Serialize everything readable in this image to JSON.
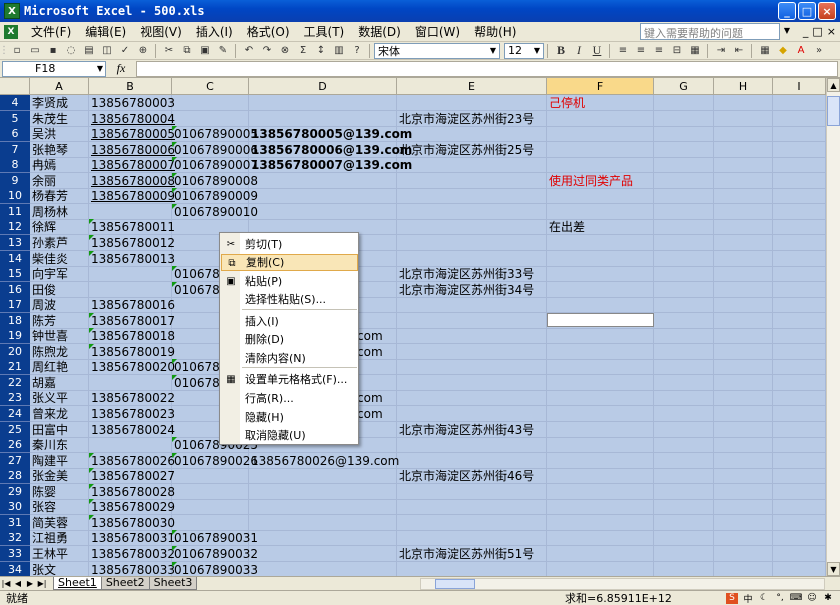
{
  "window": {
    "title": "Microsoft Excel - 500.xls",
    "app_icon": "excel-icon",
    "buttons": [
      "_",
      "□",
      "×"
    ]
  },
  "menu": {
    "items": [
      "文件(F)",
      "编辑(E)",
      "视图(V)",
      "插入(I)",
      "格式(O)",
      "工具(T)",
      "数据(D)",
      "窗口(W)",
      "帮助(H)"
    ],
    "help_placeholder": "键入需要帮助的问题",
    "doc_buttons": [
      "_",
      "□",
      "×"
    ]
  },
  "toolbar": {
    "font_name": "宋体",
    "font_size": "12",
    "sigma": "Σ",
    "bold": "B",
    "italic": "I",
    "underline": "U"
  },
  "formula_bar": {
    "name_box": "F18",
    "fx": "fx",
    "value": ""
  },
  "columns": [
    "A",
    "B",
    "C",
    "D",
    "E",
    "F",
    "G",
    "H",
    "I"
  ],
  "selected_column": "F",
  "rows": [
    {
      "n": "4",
      "A": "李贤成",
      "B": "13856780003",
      "C": "",
      "D": "",
      "E": "",
      "F": "己停机"
    },
    {
      "n": "5",
      "A": "朱茂生",
      "B": "13856780004",
      "C": "",
      "D": "",
      "E": "北京市海淀区苏州街23号",
      "F": ""
    },
    {
      "n": "6",
      "A": "吴洪",
      "B": "13856780005",
      "C": "01067890005",
      "D": "13856780005@139.com",
      "E": "",
      "F": ""
    },
    {
      "n": "7",
      "A": "张艳琴",
      "B": "13856780006",
      "C": "01067890006",
      "D": "13856780006@139.com",
      "E": "北京市海淀区苏州街25号",
      "F": ""
    },
    {
      "n": "8",
      "A": "冉嫣",
      "B": "13856780007",
      "C": "01067890007",
      "D": "13856780007@139.com",
      "E": "",
      "F": ""
    },
    {
      "n": "9",
      "A": "余丽",
      "B": "13856780008",
      "C": "01067890008",
      "D": "",
      "E": "",
      "F": "使用过同类产品"
    },
    {
      "n": "10",
      "A": "杨春芳",
      "B": "13856780009",
      "C": "01067890009",
      "D": "",
      "E": "",
      "F": ""
    },
    {
      "n": "11",
      "A": "周杨林",
      "B": "",
      "C": "01067890010",
      "D": "",
      "E": "",
      "F": ""
    },
    {
      "n": "12",
      "A": "徐辉",
      "B": "13856780011",
      "C": "",
      "D": "",
      "E": "",
      "F": "在出差"
    },
    {
      "n": "13",
      "A": "孙素芦",
      "B": "13856780012",
      "C": "",
      "D": "",
      "E": "",
      "F": ""
    },
    {
      "n": "14",
      "A": "柴佳炎",
      "B": "13856780013",
      "C": "",
      "D": "",
      "E": "",
      "F": ""
    },
    {
      "n": "15",
      "A": "向宇军",
      "B": "",
      "C": "0106789",
      "D": "",
      "E": "北京市海淀区苏州街33号",
      "F": ""
    },
    {
      "n": "16",
      "A": "田俊",
      "B": "",
      "C": "0106789",
      "D": "",
      "E": "北京市海淀区苏州街34号",
      "F": ""
    },
    {
      "n": "17",
      "A": "周波",
      "B": "13856780016",
      "C": "",
      "D": "",
      "E": "",
      "F": ""
    },
    {
      "n": "18",
      "A": "陈芳",
      "B": "13856780017",
      "C": "",
      "D": "",
      "E": "",
      "F": ""
    },
    {
      "n": "19",
      "A": "钟世喜",
      "B": "13856780018",
      "C": "",
      "D": "com",
      "E": "",
      "F": ""
    },
    {
      "n": "20",
      "A": "陈煦龙",
      "B": "13856780019",
      "C": "",
      "D": "com",
      "E": "",
      "F": ""
    },
    {
      "n": "21",
      "A": "周红艳",
      "B": "13856780020",
      "C": "0106789",
      "D": "",
      "E": "",
      "F": ""
    },
    {
      "n": "22",
      "A": "胡嘉",
      "B": "",
      "C": "0106789",
      "D": "",
      "E": "",
      "F": ""
    },
    {
      "n": "23",
      "A": "张义平",
      "B": "13856780022",
      "C": "",
      "D": "com",
      "E": "",
      "F": ""
    },
    {
      "n": "24",
      "A": "曾来龙",
      "B": "13856780023",
      "C": "",
      "D": "com",
      "E": "",
      "F": ""
    },
    {
      "n": "25",
      "A": "田富中",
      "B": "13856780024",
      "C": "",
      "D": "",
      "E": "北京市海淀区苏州街43号",
      "F": ""
    },
    {
      "n": "26",
      "A": "秦川东",
      "B": "",
      "C": "01067890025",
      "D": "",
      "E": "",
      "F": ""
    },
    {
      "n": "27",
      "A": "陶建平",
      "B": "13856780026",
      "C": "01067890026",
      "D": "13856780026@139.com",
      "E": "",
      "F": ""
    },
    {
      "n": "28",
      "A": "张金美",
      "B": "13856780027",
      "C": "",
      "D": "",
      "E": "北京市海淀区苏州街46号",
      "F": ""
    },
    {
      "n": "29",
      "A": "陈婴",
      "B": "13856780028",
      "C": "",
      "D": "",
      "E": "",
      "F": ""
    },
    {
      "n": "30",
      "A": "张容",
      "B": "13856780029",
      "C": "",
      "D": "",
      "E": "",
      "F": ""
    },
    {
      "n": "31",
      "A": "简芙蓉",
      "B": "13856780030",
      "C": "",
      "D": "",
      "E": "",
      "F": ""
    },
    {
      "n": "32",
      "A": "江祖勇",
      "B": "13856780031",
      "C": "01067890031",
      "D": "",
      "E": "",
      "F": ""
    },
    {
      "n": "33",
      "A": "王林平",
      "B": "13856780032",
      "C": "01067890032",
      "D": "",
      "E": "北京市海淀区苏州街51号",
      "F": ""
    },
    {
      "n": "34",
      "A": "张文",
      "B": "13856780033",
      "C": "01067890033",
      "D": "",
      "E": "",
      "F": ""
    }
  ],
  "context_menu": {
    "items": [
      {
        "label": "剪切(T)",
        "icon": "scissors-icon"
      },
      {
        "label": "复制(C)",
        "icon": "copy-icon"
      },
      {
        "label": "粘贴(P)",
        "icon": "paste-icon"
      },
      {
        "label": "选择性粘贴(S)...",
        "icon": ""
      },
      {
        "label": "插入(I)",
        "icon": ""
      },
      {
        "label": "删除(D)",
        "icon": ""
      },
      {
        "label": "清除内容(N)",
        "icon": ""
      },
      {
        "label": "设置单元格格式(F)...",
        "icon": "format-cells-icon"
      },
      {
        "label": "行高(R)...",
        "icon": ""
      },
      {
        "label": "隐藏(H)",
        "icon": ""
      },
      {
        "label": "取消隐藏(U)",
        "icon": ""
      }
    ],
    "highlighted": "复制(C)"
  },
  "sheets": [
    "Sheet1",
    "Sheet2",
    "Sheet3"
  ],
  "active_sheet": "Sheet1",
  "status": {
    "ready": "就绪",
    "sum": "求和=6.85911E+12"
  },
  "colors": {
    "row_header": "#0a3d8f",
    "selection": "#b9cbe6",
    "red_text": "#e00000",
    "menu_highlight": "#f9e6b7"
  }
}
